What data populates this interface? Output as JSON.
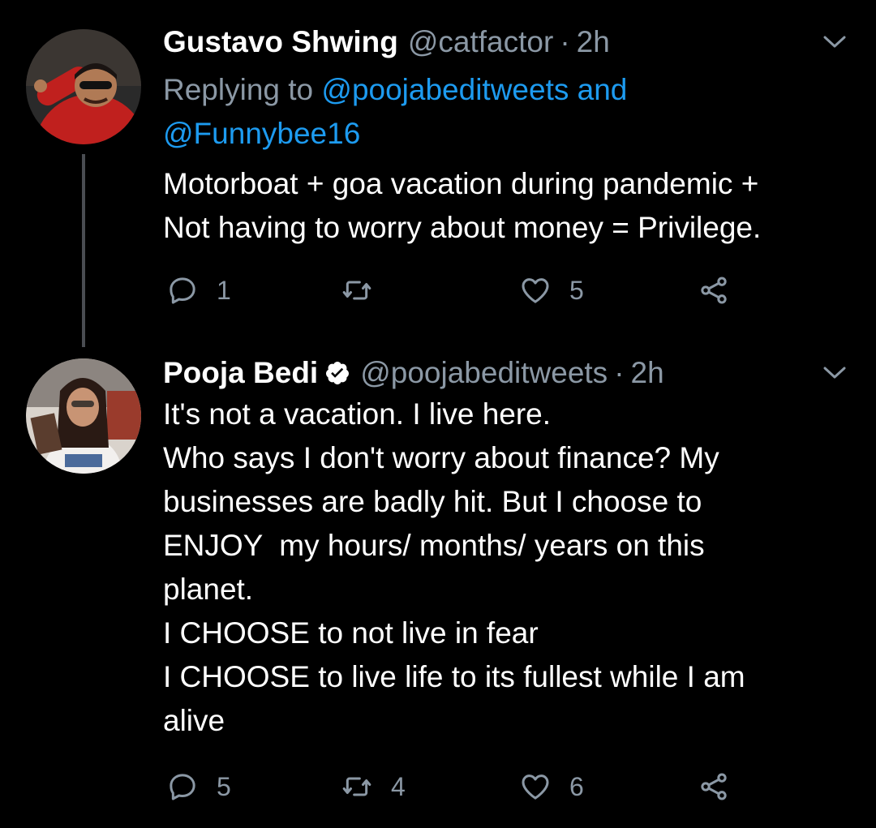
{
  "colors": {
    "background": "#000000",
    "secondary_text": "#8b98a5",
    "link": "#1d9bf0",
    "thread_line": "#4a4d52"
  },
  "tweets": [
    {
      "name": "Gustavo Shwing",
      "handle": "@catfactor",
      "separator": "·",
      "time": "2h",
      "verified": false,
      "replying_prefix": "Replying to",
      "replying_to_line1": "@poojabeditweets and",
      "replying_to_line2": "@Funnybee16",
      "text": "Motorboat + goa vacation during pandemic +\nNot having to worry about money = Privilege.",
      "reply_count": "1",
      "retweet_count": "",
      "like_count": "5",
      "icons": [
        "reply-icon",
        "retweet-icon",
        "like-icon",
        "share-icon"
      ]
    },
    {
      "name": "Pooja Bedi",
      "handle": "@poojabeditweets",
      "separator": "·",
      "time": "2h",
      "verified": true,
      "text": "It's not a vacation. I live here.\nWho says I don't worry about finance? My\nbusinesses are badly hit. But I choose to\nENJOY  my hours/ months/ years on this\nplanet.\nI CHOOSE to not live in fear\nI CHOOSE to live life to its fullest while I am\nalive",
      "reply_count": "5",
      "retweet_count": "4",
      "like_count": "6",
      "icons": [
        "reply-icon",
        "retweet-icon",
        "like-icon",
        "share-icon"
      ]
    }
  ]
}
